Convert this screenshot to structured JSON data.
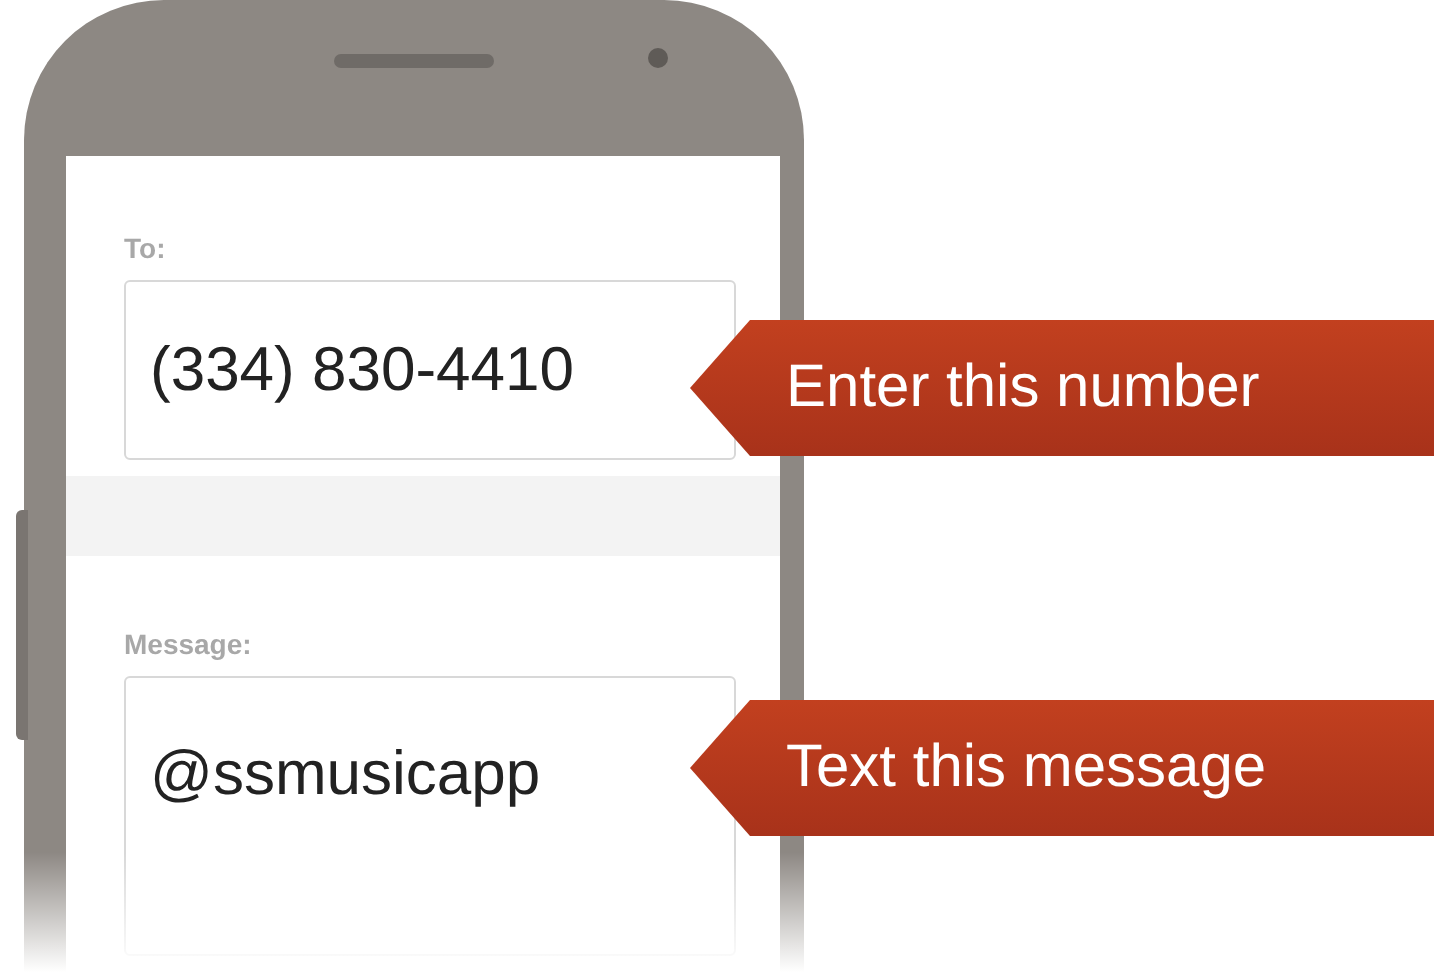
{
  "form": {
    "fields": [
      {
        "label": "To:",
        "value": "(334) 830-4410"
      },
      {
        "label": "Message:",
        "value": "@ssmusicapp"
      }
    ]
  },
  "callouts": [
    {
      "text": "Enter this number"
    },
    {
      "text": "Text this message"
    }
  ]
}
